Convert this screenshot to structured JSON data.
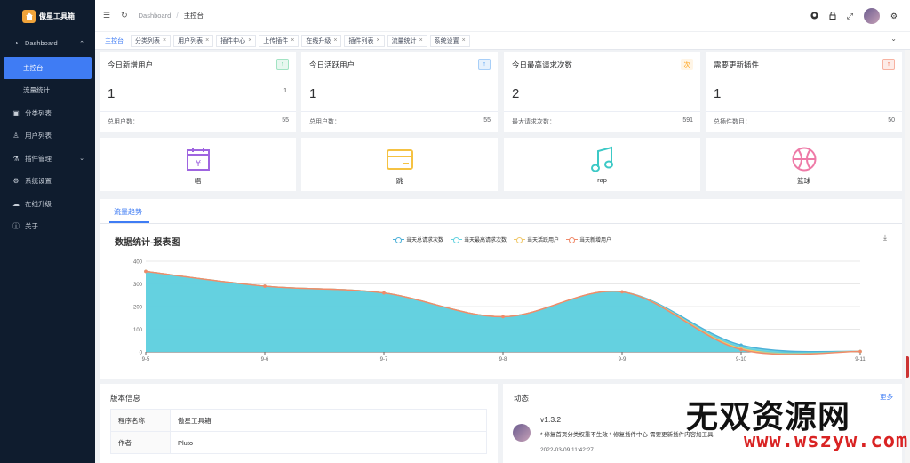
{
  "app": {
    "title": "傲星工具箱"
  },
  "sidebar": {
    "items": [
      {
        "label": "Dashboard",
        "icon": "dashboard-icon",
        "expandable": true
      },
      {
        "label": "主控台",
        "sub": true,
        "active": true
      },
      {
        "label": "流量统计",
        "sub": true
      },
      {
        "label": "分类列表",
        "icon": "gift-icon"
      },
      {
        "label": "用户列表",
        "icon": "users-icon"
      },
      {
        "label": "插件管理",
        "icon": "plugin-icon",
        "expandable": true
      },
      {
        "label": "系统设置",
        "icon": "gear-icon"
      },
      {
        "label": "在线升级",
        "icon": "cloud-icon"
      },
      {
        "label": "关于",
        "icon": "info-icon"
      }
    ]
  },
  "header": {
    "breadcrumb": [
      "Dashboard",
      "主控台"
    ]
  },
  "tabs": [
    {
      "label": "主控台",
      "active": true,
      "closable": false
    },
    {
      "label": "分类列表",
      "closable": true
    },
    {
      "label": "用户列表",
      "closable": true
    },
    {
      "label": "插件中心",
      "closable": true
    },
    {
      "label": "上传插件",
      "closable": true
    },
    {
      "label": "在线升级",
      "closable": true
    },
    {
      "label": "插件列表",
      "closable": true
    },
    {
      "label": "流量统计",
      "closable": true
    },
    {
      "label": "系统设置",
      "closable": true
    }
  ],
  "stats": [
    {
      "title": "今日新增用户",
      "badge": "↑",
      "badge_color": "#19be6b",
      "badge_bg": "#e7f7ef",
      "value": "1",
      "small": "1",
      "foot_label": "总用户数：",
      "foot_value": "55"
    },
    {
      "title": "今日活跃用户",
      "badge": "↑",
      "badge_color": "#2d8cf0",
      "badge_bg": "#e6f1fc",
      "value": "1",
      "small": "",
      "foot_label": "总用户数：",
      "foot_value": "55"
    },
    {
      "title": "今日最高请求次数",
      "badge": "次",
      "badge_color": "#f90",
      "badge_bg": "#fff5e6",
      "value": "2",
      "small": "",
      "foot_label": "最大请求次数：",
      "foot_value": "591"
    },
    {
      "title": "需要更新插件",
      "badge": "↑",
      "badge_color": "#ed4014",
      "badge_bg": "#fdece8",
      "value": "1",
      "small": "",
      "foot_label": "总插件数目：",
      "foot_value": "50"
    }
  ],
  "shortcuts": [
    {
      "label": "唱",
      "icon": "calendar-yen-icon",
      "color": "#9f65e0"
    },
    {
      "label": "跳",
      "icon": "card-icon",
      "color": "#f5c242"
    },
    {
      "label": "rap",
      "icon": "music-icon",
      "color": "#3cc9c6"
    },
    {
      "label": "篮球",
      "icon": "basketball-icon",
      "color": "#ee7aa7"
    }
  ],
  "chart_tab": "流量趋势",
  "chart_data": {
    "type": "area",
    "title": "数据统计-报表图",
    "x": [
      "9-5",
      "9-6",
      "9-7",
      "9-8",
      "9-9",
      "9-10",
      "9-11"
    ],
    "ylim": [
      0,
      400
    ],
    "yticks": [
      0,
      100,
      200,
      300,
      400
    ],
    "grid": true,
    "legend": "top",
    "series": [
      {
        "name": "当天总请求次数",
        "color": "#4cb0d8",
        "values": [
          355,
          290,
          260,
          155,
          265,
          30,
          2
        ]
      },
      {
        "name": "当天最高请求次数",
        "color": "#62d2e0",
        "values": [
          355,
          290,
          260,
          155,
          265,
          20,
          2
        ]
      },
      {
        "name": "当天活跃用户",
        "color": "#f0c86a",
        "values": [
          355,
          290,
          260,
          155,
          265,
          15,
          2
        ]
      },
      {
        "name": "当天新增用户",
        "color": "#f08a6a",
        "values": [
          355,
          290,
          260,
          155,
          265,
          10,
          2
        ]
      }
    ]
  },
  "version": {
    "title": "版本信息",
    "rows": [
      {
        "key": "程序名称",
        "value": "傲星工具箱"
      },
      {
        "key": "作者",
        "value": "Pluto"
      }
    ]
  },
  "news": {
    "title": "动态",
    "more": "更多",
    "version": "v1.3.2",
    "text": "* 修复首页分类权重不生效 * 修复插件中心-需要更新插件内容加工具",
    "time": "2022-03-09 11:42:27"
  },
  "watermark": {
    "big": "无双资源网",
    "small": "www.wszyw.com"
  }
}
